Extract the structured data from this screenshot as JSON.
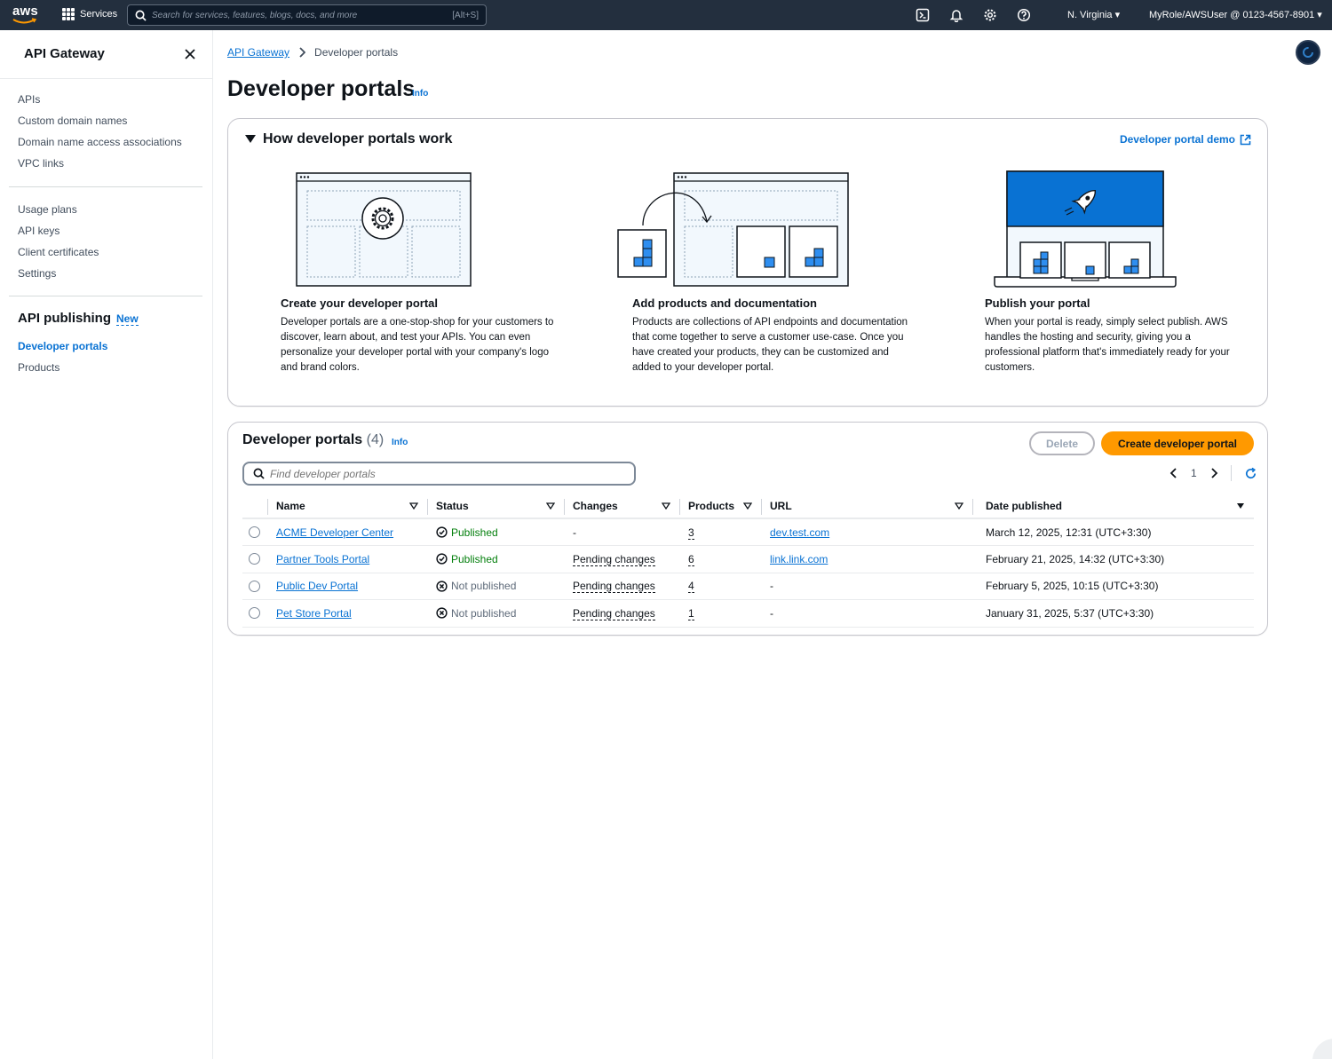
{
  "topnav": {
    "logo_text": "aws",
    "services_label": "Services",
    "search_placeholder": "Search for services, features, blogs, docs, and more",
    "search_shortcut": "[Alt+S]",
    "region": "N. Virginia",
    "account": "MyRole/AWSUser @ 0123-4567-8901",
    "icons": [
      "cloudshell-icon",
      "notifications-icon",
      "settings-icon",
      "help-icon"
    ]
  },
  "sidebar": {
    "title": "API Gateway",
    "group1": [
      "APIs",
      "Custom domain names",
      "Domain name access associations",
      "VPC links"
    ],
    "group2": [
      "Usage plans",
      "API keys",
      "Client certificates",
      "Settings"
    ],
    "section_title": "API publishing",
    "section_badge": "New",
    "group3": [
      "Developer portals",
      "Products"
    ],
    "active_item": "Developer portals"
  },
  "breadcrumb": {
    "root": "API Gateway",
    "current": "Developer portals"
  },
  "page": {
    "title": "Developer portals",
    "info": "Info"
  },
  "how": {
    "title": "How developer portals work",
    "demo_link": "Developer portal demo",
    "steps": [
      {
        "title": "Create your developer portal",
        "body": "Developer portals are a one-stop-shop for your customers to discover, learn about, and test your APIs. You can even personalize your developer portal with your company's logo and brand colors."
      },
      {
        "title": "Add products and documentation",
        "body": "Products are collections of API endpoints and documentation that come together to serve a customer use-case. Once you have created your products, they can be customized and added to your developer portal."
      },
      {
        "title": "Publish your portal",
        "body": "When your portal is ready, simply select publish. AWS handles the hosting and security, giving you a professional platform that's immediately ready for your customers."
      }
    ]
  },
  "portals": {
    "title": "Developer portals",
    "count": "(4)",
    "info": "Info",
    "delete_label": "Delete",
    "create_label": "Create developer portal",
    "filter_placeholder": "Find developer portals",
    "page_number": "1",
    "columns": [
      "Name",
      "Status",
      "Changes",
      "Products",
      "URL",
      "Date published"
    ],
    "rows": [
      {
        "name": "ACME Developer Center",
        "status": "Published",
        "changes": "-",
        "products": "3",
        "url": "dev.test.com",
        "date": "March 12, 2025, 12:31 (UTC+3:30)"
      },
      {
        "name": "Partner Tools Portal",
        "status": "Published",
        "changes": "Pending changes",
        "products": "6",
        "url": "link.link.com",
        "date": "February 21, 2025, 14:32 (UTC+3:30)"
      },
      {
        "name": "Public Dev Portal",
        "status": "Not published",
        "changes": "Pending changes",
        "products": "4",
        "url": "-",
        "date": "February 5, 2025, 10:15 (UTC+3:30)"
      },
      {
        "name": "Pet Store Portal",
        "status": "Not published",
        "changes": "Pending changes",
        "products": "1",
        "url": "-",
        "date": "January 31, 2025, 5:37 (UTC+3:30)"
      }
    ]
  },
  "colors": {
    "nav_bg": "#232f3e",
    "link": "#0972d3",
    "primary_button": "#ff9900",
    "success": "#037f0c",
    "illustration_blue": "#0972d3"
  }
}
